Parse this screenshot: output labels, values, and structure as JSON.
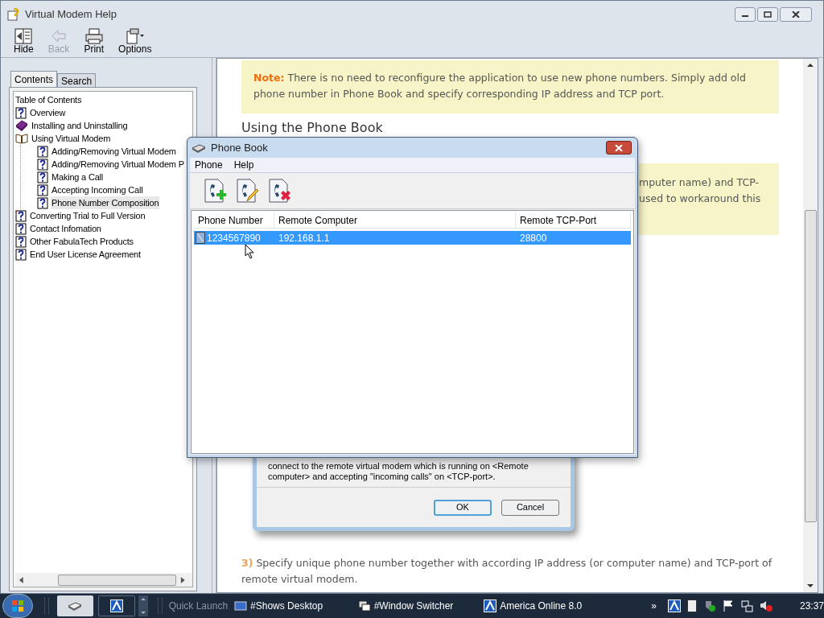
{
  "help_window": {
    "title": "Virtual Modem Help",
    "toolbar": [
      {
        "label": "Hide",
        "kind": "hide",
        "disabled": false
      },
      {
        "label": "Back",
        "kind": "back",
        "disabled": true
      },
      {
        "label": "Print",
        "kind": "print",
        "disabled": false
      },
      {
        "label": "Options",
        "kind": "options",
        "disabled": false
      }
    ],
    "tabs": [
      {
        "label": "Contents",
        "selected": true
      },
      {
        "label": "Search",
        "selected": false
      }
    ],
    "tree": {
      "label": "Table of Contents",
      "children": [
        {
          "label": "Overview",
          "kind": "page",
          "selected": false
        },
        {
          "label": "Installing and Uninstalling",
          "kind": "book",
          "expanded": false,
          "selected": false
        },
        {
          "label": "Using Virtual Modem",
          "kind": "book",
          "expanded": true,
          "selected": false,
          "children": [
            {
              "label": "Adding/Removing Virtual Modem",
              "kind": "page",
              "selected": false
            },
            {
              "label": "Adding/Removing Virtual Modem P",
              "kind": "page",
              "selected": false
            },
            {
              "label": "Making a Call",
              "kind": "page",
              "selected": false
            },
            {
              "label": "Accepting Incoming Call",
              "kind": "page",
              "selected": false
            },
            {
              "label": "Phone Number Composition",
              "kind": "page",
              "selected": true
            }
          ]
        },
        {
          "label": "Converting Trial to Full Version",
          "kind": "new-page",
          "selected": false
        },
        {
          "label": "Contact Infomation",
          "kind": "page",
          "selected": false
        },
        {
          "label": "Other FabulaTech Products",
          "kind": "page",
          "selected": false
        },
        {
          "label": "End User License Agreement",
          "kind": "page",
          "selected": false
        }
      ]
    },
    "content": {
      "note": {
        "label": "Note:",
        "text": "There is no need to reconfigure the application to use new phone numbers. Simply add old phone number in Phone Book and specify corresponding IP address and TCP port."
      },
      "heading": "Using the Phone Book",
      "note2_lines": [
        "mputer name) and TCP-",
        "used to workaround this"
      ],
      "dialog_image": {
        "text": "connect to the remote virtual modem which is running on <Remote computer> and accepting \"incoming calls\" on <TCP-port>.",
        "buttons": [
          {
            "label": "OK",
            "default": true
          },
          {
            "label": "Cancel",
            "default": false
          }
        ]
      },
      "step": {
        "number": "3)",
        "text": "Specify unique phone number together with according IP address (or computer name) and TCP-port of remote virtual modem."
      }
    }
  },
  "phone_book": {
    "title": "Phone Book",
    "menu": [
      "Phone",
      "Help"
    ],
    "toolbar": [
      {
        "kind": "add"
      },
      {
        "kind": "edit"
      },
      {
        "kind": "delete"
      }
    ],
    "columns": [
      "Phone Number",
      "Remote Computer",
      "Remote TCP-Port"
    ],
    "rows": [
      {
        "cells": [
          "1234567890",
          "192.168.1.1",
          "28800"
        ],
        "selected": true
      }
    ]
  },
  "taskbar": {
    "quick_launch": "Quick Launch",
    "items": [
      {
        "label": "#Shows Desktop",
        "kind": "desktop"
      },
      {
        "label": "#Window Switcher",
        "kind": "switcher"
      },
      {
        "label": "America Online 8.0",
        "kind": "aol"
      }
    ],
    "chevron": "»",
    "clock": "23:37"
  }
}
